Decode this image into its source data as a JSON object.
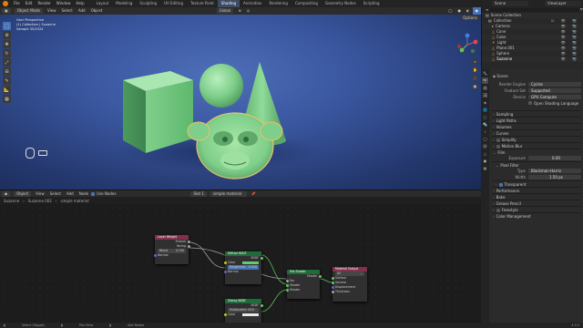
{
  "topbar": {
    "menus": [
      "File",
      "Edit",
      "Render",
      "Window",
      "Help"
    ],
    "workspaces": [
      "Layout",
      "Modeling",
      "Sculpting",
      "UV Editing",
      "Texture Paint",
      "Shading",
      "Animation",
      "Rendering",
      "Compositing",
      "Geometry Nodes",
      "Scripting"
    ],
    "active_workspace": "Shading",
    "scene": "Scene",
    "view_layer": "ViewLayer"
  },
  "viewport": {
    "mode": "Object Mode",
    "menus": [
      "View",
      "Select",
      "Add",
      "Object"
    ],
    "shading_mode": "Global",
    "options": "Options",
    "info": [
      "User Perspective",
      "(1) Collection | Suzanne",
      "Sample 35/1024"
    ]
  },
  "outliner": {
    "title": "Scene Collection",
    "items": [
      "Collection",
      "Camera",
      "Cone",
      "Cube",
      "Light",
      "Plane.001",
      "Sphere",
      "Suzanne"
    ],
    "selected": "Suzanne"
  },
  "properties": {
    "section": "Scene",
    "render_engine_label": "Render Engine",
    "render_engine": "Cycles",
    "feature_set_label": "Feature Set",
    "feature_set": "Supported",
    "device_label": "Device",
    "device": "GPU Compute",
    "osl_label": "Open Shading Language",
    "sections_a": [
      "Sampling",
      "Light Paths",
      "Volumes",
      "Curves",
      "Simplify",
      "Motion Blur",
      "Film"
    ],
    "exposure_label": "Exposure",
    "exposure": "0.00",
    "pixel_filter": "Pixel Filter",
    "type_label": "Type",
    "type": "Blackman-Harris",
    "width_label": "Width",
    "width": "1.50 px",
    "transparent": "Transparent",
    "sections_b": [
      "Performance",
      "Bake",
      "Grease Pencil",
      "Freestyle",
      "Color Management"
    ]
  },
  "node_editor": {
    "type": "Object",
    "menus": [
      "View",
      "Select",
      "Add",
      "Node"
    ],
    "use_nodes": "Use Nodes",
    "slot": "Slot 1",
    "material": "simple material",
    "breadcrumb": [
      "Suzanne",
      "Suzanne.002",
      "simple material"
    ]
  },
  "nodes": {
    "layer_weight": {
      "title": "Layer Weight",
      "out1": "Fresnel",
      "out2": "Facing",
      "blend_label": "Blend",
      "blend": "0.740",
      "normal": "Normal"
    },
    "diffuse": {
      "title": "Diffuse BSDF",
      "out": "BSDF",
      "color": "Color",
      "roughness_label": "Roughness",
      "roughness": "0.000",
      "normal": "Normal"
    },
    "glossy": {
      "title": "Glossy BSDF",
      "out": "BSDF",
      "distribution": "Multiscatter GGX",
      "color": "Color"
    },
    "mix": {
      "title": "Mix Shader",
      "out": "Shader",
      "fac": "Fac",
      "s1": "Shader",
      "s2": "Shader"
    },
    "output": {
      "title": "Material Output",
      "target": "All",
      "surface": "Surface",
      "volume": "Volume",
      "displacement": "Displacement",
      "thickness": "Thickness"
    }
  },
  "statusbar": {
    "select": "Select (Toggle)",
    "pan": "Pan View",
    "nodes": "Add Nodes",
    "version": "4.0.0"
  }
}
